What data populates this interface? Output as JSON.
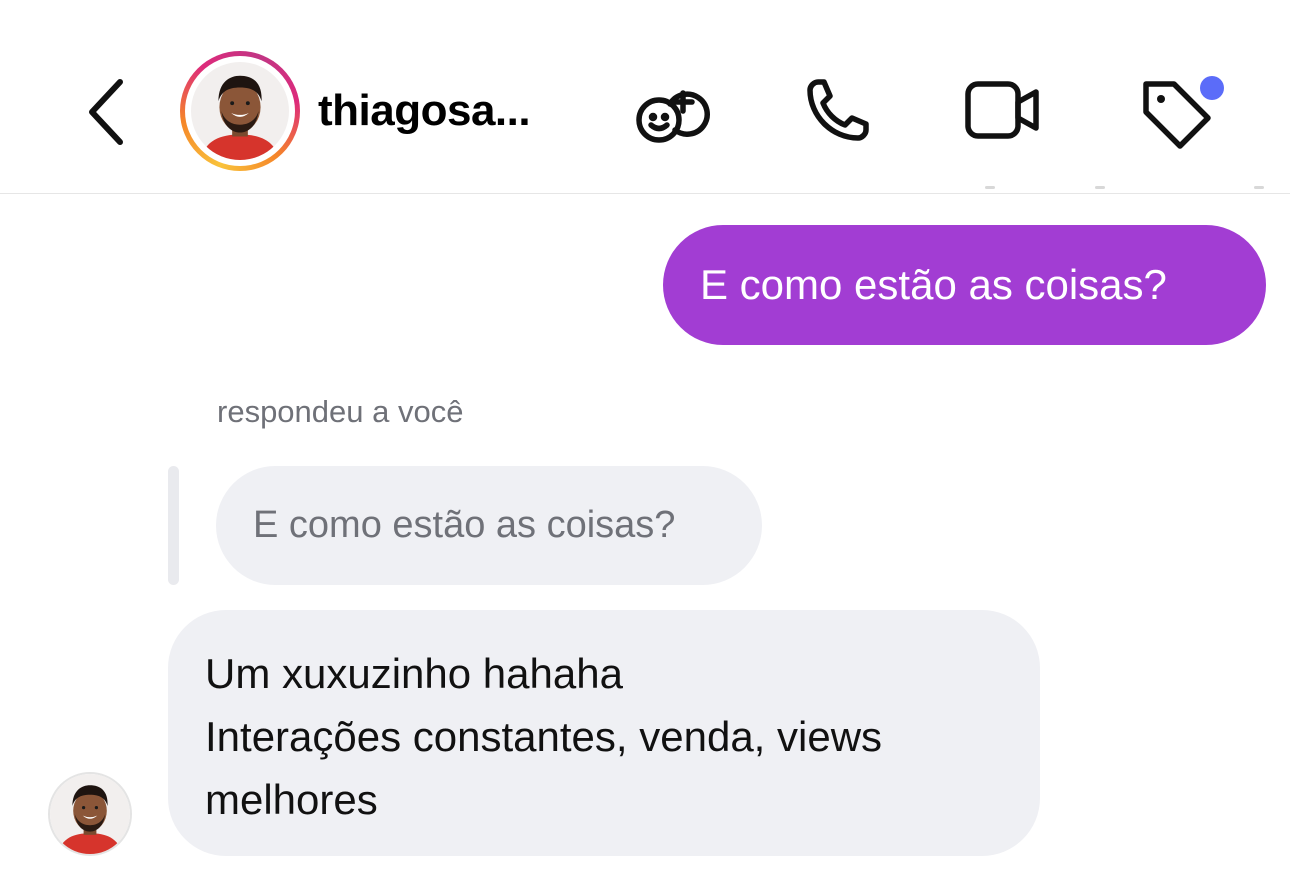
{
  "header": {
    "back_icon": "chevron-left-icon",
    "username": "thiagosa...",
    "icons": [
      "add-people-icon",
      "phone-icon",
      "video-camera-icon",
      "tag-icon"
    ],
    "tag_dot_color": "#5b6cf9"
  },
  "messages": {
    "outgoing_1": "E como estão as coisas?",
    "reply_caption": "respondeu a você",
    "quoted_text": "E como estão as coisas?",
    "incoming_lines": [
      "Um xuxuzinho hahaha",
      "Interações constantes, venda, views",
      "melhores"
    ]
  },
  "colors": {
    "outgoing_bubble": "#a23dd3",
    "incoming_bubble": "#eff0f4",
    "secondary_text": "#6f7178"
  }
}
